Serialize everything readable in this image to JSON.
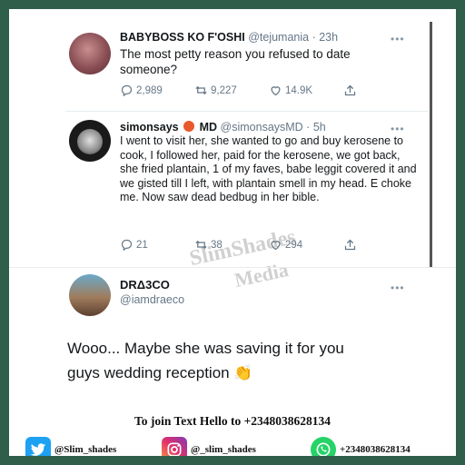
{
  "tweet1": {
    "display_name": "BABYBOSS KO F'OSHI",
    "handle_time": "@tejumania · 23h",
    "text": "The most petty reason you refused to date someone?",
    "replies": "2,989",
    "retweets": "9,227",
    "likes": "14.9K"
  },
  "tweet2": {
    "display_name": "simonsays",
    "badge": "MD",
    "handle_time": "@simonsaysMD · 5h",
    "text": "I went to visit her, she wanted to go and buy kerosene to cook, I followed her, paid for the kerosene, we got back, she fried plantain, 1 of my faves, babe leggit covered it and we gisted till I left, with plantain smell in my head. E choke me. Now saw dead bedbug in her bible.",
    "replies": "21",
    "retweets": "38",
    "likes": "294"
  },
  "tweet3": {
    "display_name": "DRΔ3CO",
    "handle": "@iamdraeco",
    "text": "Wooo... Maybe she was saving it for you guys wedding reception",
    "emoji": "👏"
  },
  "watermark": {
    "line1": "SlimShades",
    "line2": "Media"
  },
  "footer": {
    "join_text": "To join Text Hello to +2348038628134",
    "twitter": "@Slim_shades",
    "instagram": "@_slim_shades",
    "whatsapp": "+2348038628134"
  },
  "more_glyph": "•••",
  "colors": {
    "twitter_blue": "#1da1f2",
    "whatsapp_green": "#25d366",
    "border_green": "#2f5f4a"
  }
}
